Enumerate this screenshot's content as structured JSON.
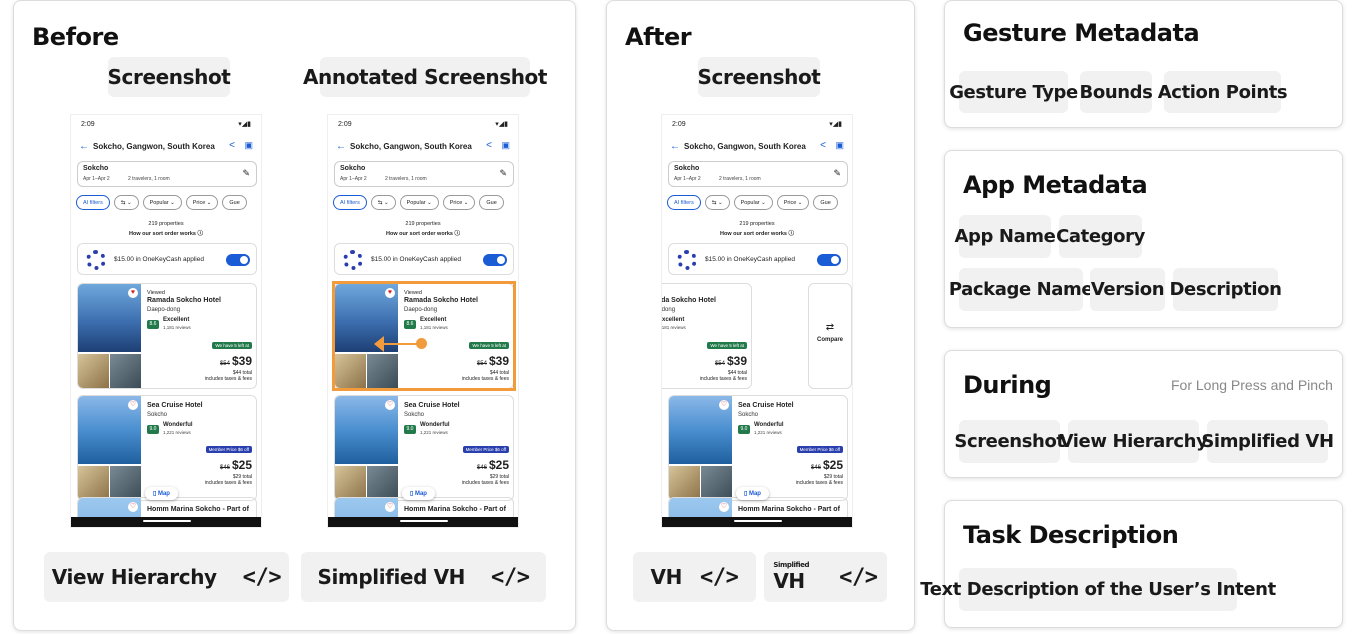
{
  "before": {
    "title": "Before",
    "screenshot_label": "Screenshot",
    "annotated_label": "Annotated Screenshot",
    "view_hierarchy_label": "View Hierarchy",
    "simplified_vh_label": "Simplified VH",
    "code_icon": "</>"
  },
  "after": {
    "title": "After",
    "screenshot_label": "Screenshot",
    "vh_label": "VH",
    "simplified_small": "Simplified",
    "simplified_vh_short": "VH",
    "code_icon": "</>"
  },
  "gesture_metadata": {
    "title": "Gesture Metadata",
    "chips": [
      "Gesture Type",
      "Bounds",
      "Action Points"
    ]
  },
  "app_metadata": {
    "title": "App Metadata",
    "chips": [
      "App Name",
      "Category",
      "Package Name",
      "Version",
      "Description"
    ]
  },
  "during": {
    "title": "During",
    "note": "For Long Press and Pinch",
    "chips": [
      "Screenshot",
      "View Hierarchy",
      "Simplified VH"
    ]
  },
  "task_description": {
    "title": "Task Description",
    "chips": [
      "Text Description of the User’s Intent"
    ]
  },
  "phone": {
    "time": "2:09",
    "status_right": "▾◢▮",
    "location": "Sokcho, Gangwon, South Korea",
    "search_city": "Sokcho",
    "dates": "Apr 1–Apr 2",
    "travelers": "2 travelers, 1 room",
    "filters": [
      "AI filters",
      "⇆ ⌄",
      "Popular ⌄",
      "Price ⌄",
      "Gue"
    ],
    "count": "219 properties",
    "sort": "How our sort order works ⓘ",
    "cash": "$15.00 in OneKeyCash applied",
    "hotel1": {
      "viewed": "Viewed",
      "name": "Ramada Sokcho Hotel",
      "area": "Daepo-dong",
      "score": "8.6",
      "rating": "Excellent",
      "reviews": "1,181 reviews",
      "badge": "We have 5 left at",
      "old_price": "$54",
      "price": "$39",
      "total": "$44 total",
      "taxes": "includes taxes & fees"
    },
    "hotel2": {
      "name": "Sea Cruise Hotel",
      "area": "Sokcho",
      "score": "9.0",
      "rating": "Wonderful",
      "reviews": "1,221 reviews",
      "badge": "Member Price $6 off",
      "old_price": "$46",
      "price": "$25",
      "total": "$29 total",
      "taxes": "includes taxes & fees"
    },
    "hotel3": {
      "name": "Homm Marina Sokcho - Part of"
    },
    "map": "Map",
    "compare": "Compare"
  }
}
